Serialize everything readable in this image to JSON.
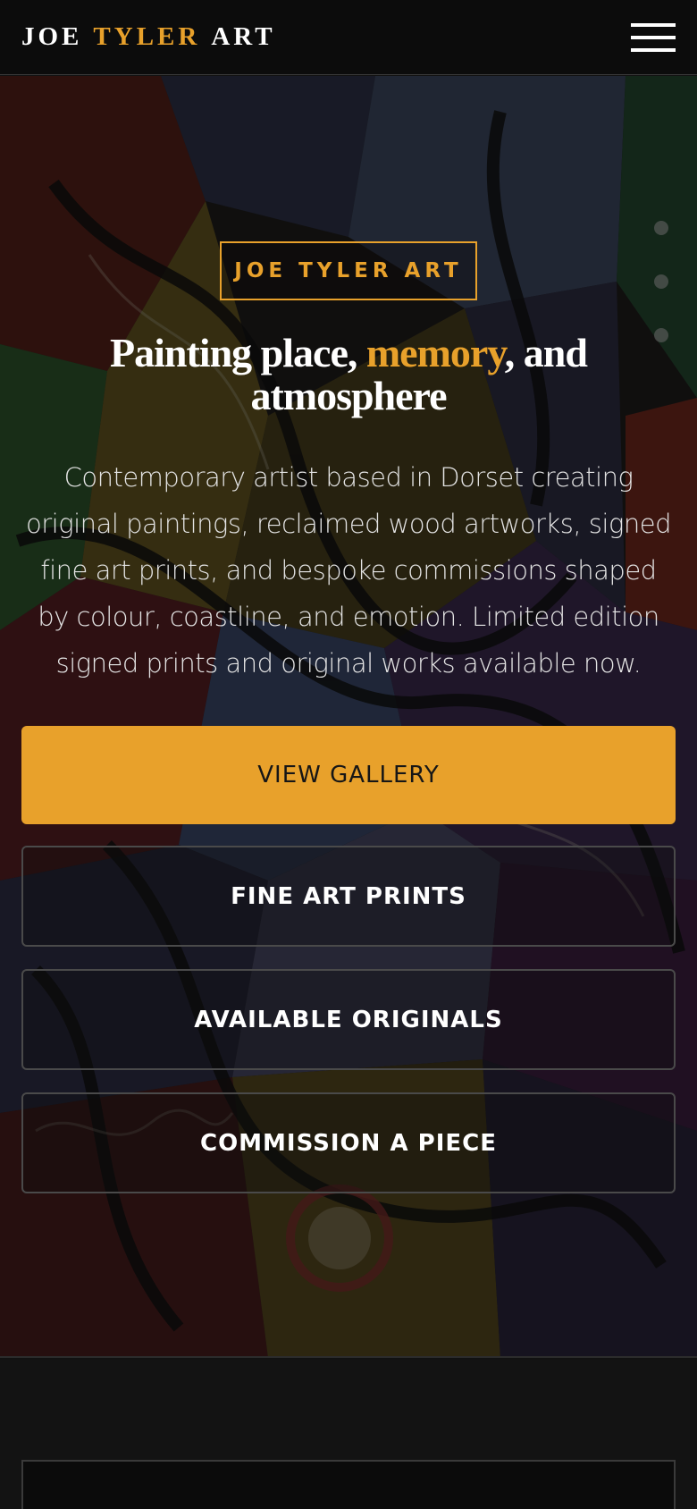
{
  "header": {
    "logo_word_1": "JOE",
    "logo_word_2": "TYLER",
    "logo_word_3": "ART",
    "menu_icon": "hamburger-icon"
  },
  "hero": {
    "eyebrow": "JOE TYLER ART",
    "headline_part_1": "Painting place, ",
    "headline_accent": "memory",
    "headline_part_2": ", and atmosphere",
    "intro": "Contemporary artist based in Dorset creating original paintings, reclaimed wood artworks, signed fine art prints, and bespoke commissions shaped by colour, coastline, and emotion. Limited edition signed prints and original works available now.",
    "buttons": {
      "primary": "VIEW GALLERY",
      "prints": "FINE ART PRINTS",
      "originals": "AVAILABLE ORIGINALS",
      "commission": "COMMISSION A PIECE"
    }
  },
  "colors": {
    "accent": "#e8a12b",
    "background": "#111111",
    "text": "#ffffff"
  }
}
